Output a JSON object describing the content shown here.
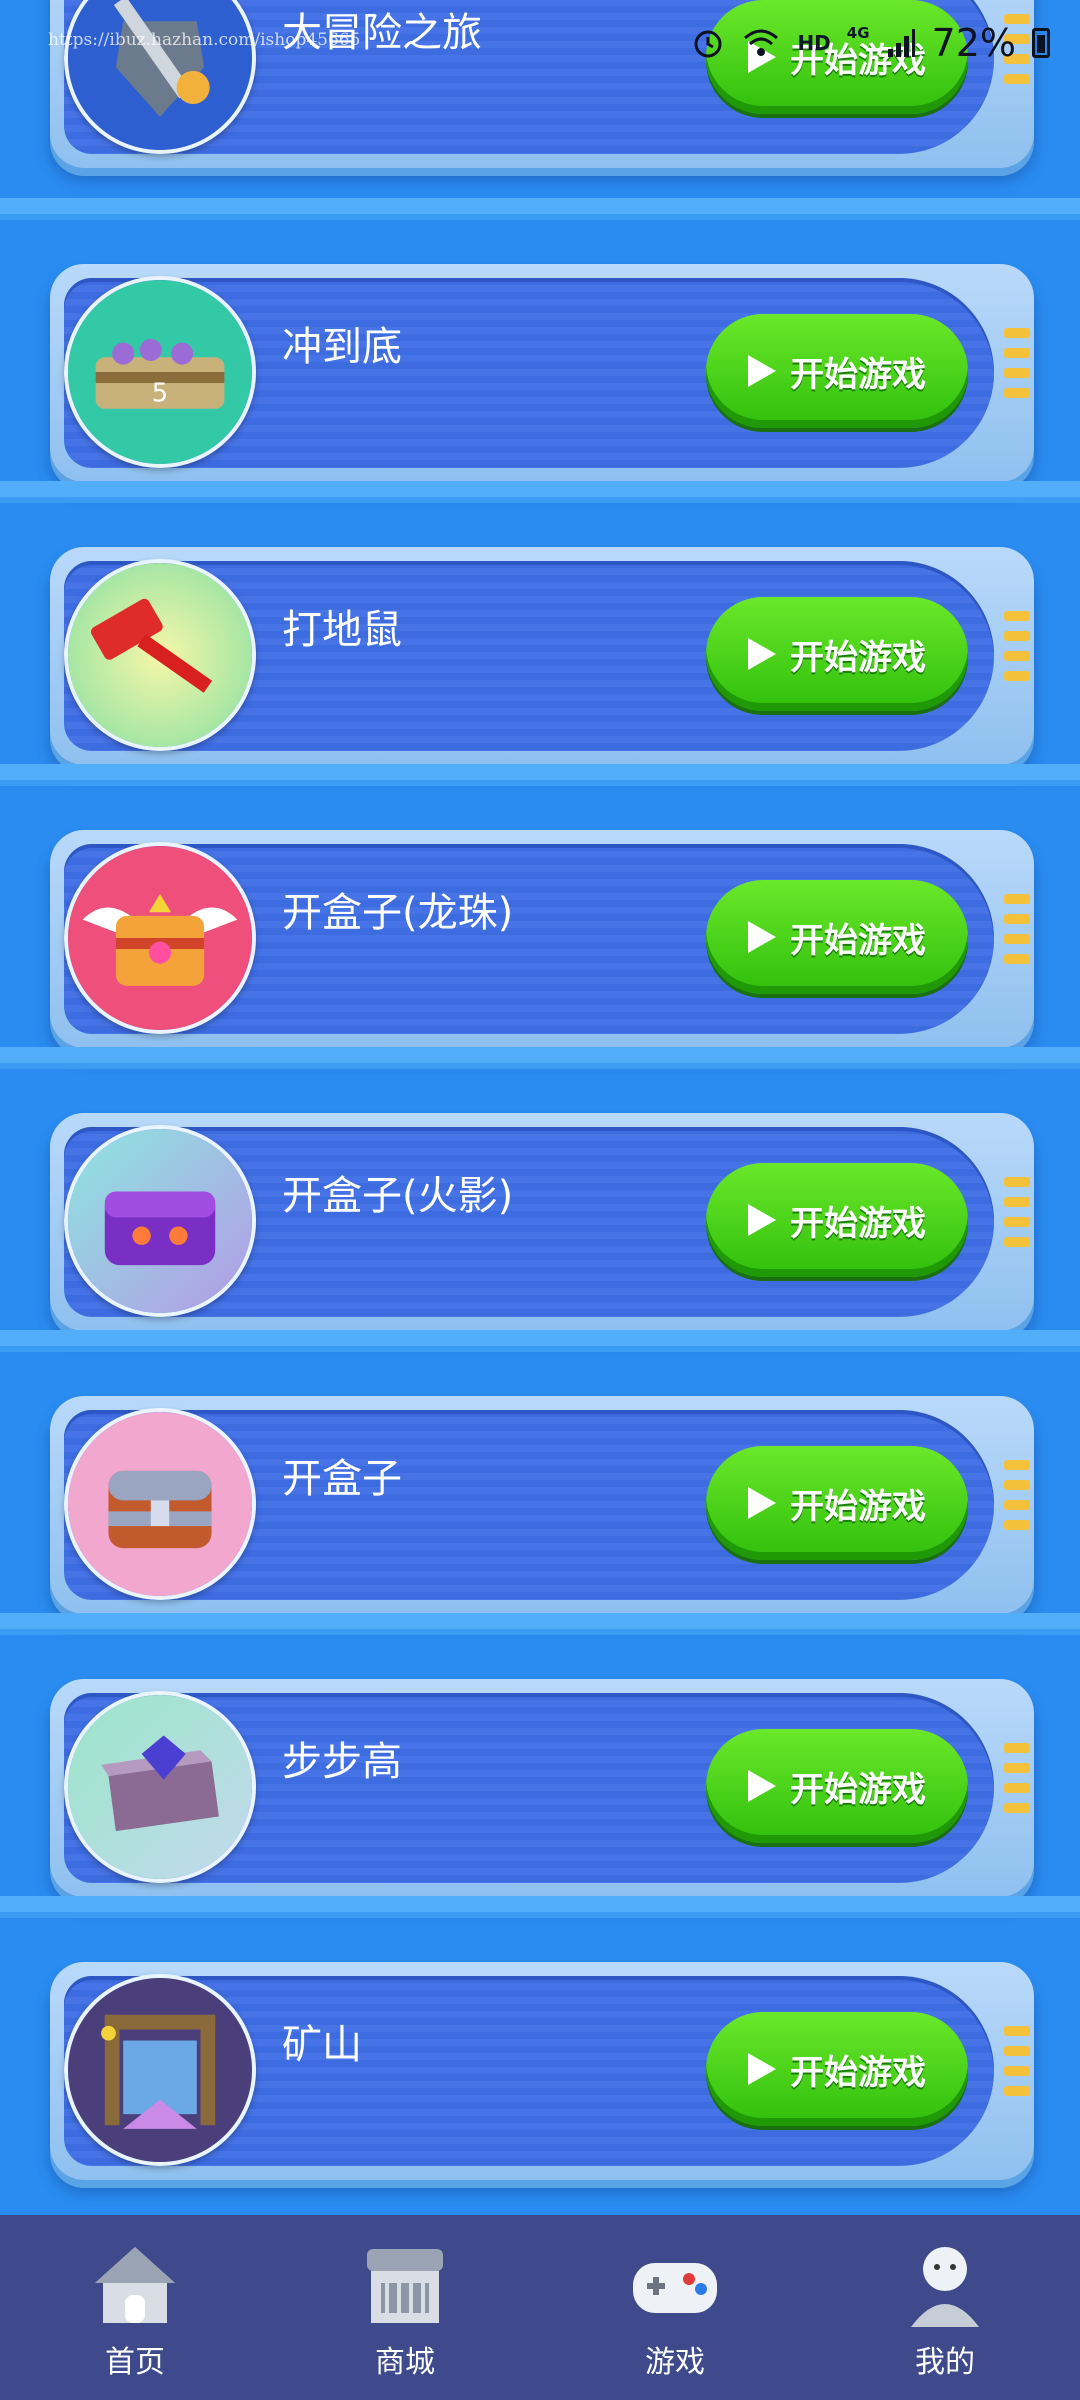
{
  "status_bar": {
    "watermark": "https://ibuz.hazhan.com/ishop45665",
    "hd": "HD",
    "network": "4G",
    "battery": "72%"
  },
  "games": [
    {
      "title": "大冒险之旅",
      "button": "开始游戏",
      "icon": "sword-shield-icon"
    },
    {
      "title": "冲到底",
      "button": "开始游戏",
      "icon": "mine-cart-icon"
    },
    {
      "title": "打地鼠",
      "button": "开始游戏",
      "icon": "hammer-icon"
    },
    {
      "title": "开盒子(龙珠)",
      "button": "开始游戏",
      "icon": "winged-chest-icon"
    },
    {
      "title": "开盒子(火影)",
      "button": "开始游戏",
      "icon": "purple-chest-icon"
    },
    {
      "title": "开盒子",
      "button": "开始游戏",
      "icon": "treasure-chest-icon"
    },
    {
      "title": "步步高",
      "button": "开始游戏",
      "icon": "gem-box-icon"
    },
    {
      "title": "矿山",
      "button": "开始游戏",
      "icon": "mine-scene-icon"
    }
  ],
  "bottom_nav": [
    {
      "label": "首页",
      "icon": "home-icon"
    },
    {
      "label": "商城",
      "icon": "shop-icon"
    },
    {
      "label": "游戏",
      "icon": "gamepad-icon"
    },
    {
      "label": "我的",
      "icon": "user-icon"
    }
  ],
  "colors": {
    "background": "#2a8cf0",
    "card_inner": "#3d6be0",
    "play_button": "#3fce12",
    "nav_bar": "#3e4a8c"
  }
}
